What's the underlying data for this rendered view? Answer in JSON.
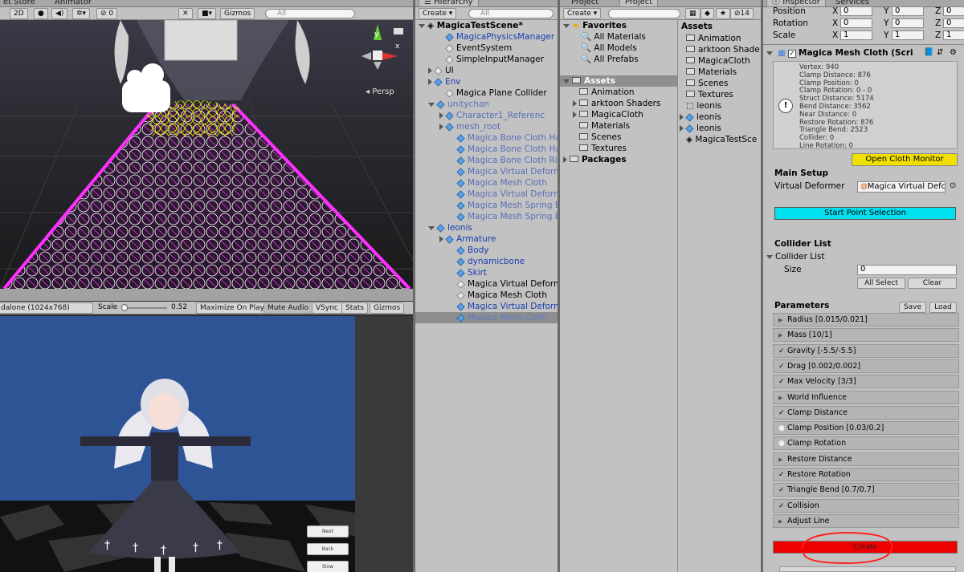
{
  "scene_view": {
    "tabs": [
      "et Store",
      "Animator"
    ],
    "toolbar": {
      "mode_2d": "2D",
      "counter": "0",
      "gizmos": "Gizmos",
      "search_placeholder": "All"
    },
    "persp_label": "Persp",
    "gizmo_axes": {
      "y": "y",
      "x": "x"
    }
  },
  "game_view": {
    "toolbar": {
      "resolution": "dalone (1024x768)",
      "scale_label": "Scale",
      "scale_value": "0.52",
      "maximize": "Maximize On Play",
      "mute": "Mute Audio",
      "vsync": "VSync",
      "stats": "Stats",
      "gizmos": "Gizmos"
    },
    "buttons": [
      "Next",
      "Back",
      "Slow"
    ]
  },
  "hierarchy": {
    "tab": "Hierarchy",
    "create": "Create",
    "search_placeholder": "All",
    "scene_name": "MagicaTestScene*",
    "items": [
      {
        "label": "MagicaPhysicsManager",
        "style": "blue"
      },
      {
        "label": "EventSystem",
        "style": "normal"
      },
      {
        "label": "SimpleInputManager",
        "style": "normal"
      },
      {
        "label": "UI",
        "style": "normal"
      },
      {
        "label": "Env",
        "style": "blue"
      },
      {
        "label": "Magica Plane Collider",
        "style": "normal"
      },
      {
        "label": "unitychan",
        "style": "faded"
      },
      {
        "label": "Character1_Referenc",
        "style": "faded"
      },
      {
        "label": "mesh_root",
        "style": "faded"
      },
      {
        "label": "Magica Bone Cloth Ha",
        "style": "faded"
      },
      {
        "label": "Magica Bone Cloth Ha",
        "style": "faded"
      },
      {
        "label": "Magica Bone Cloth Rib",
        "style": "faded"
      },
      {
        "label": "Magica Virtual Deform",
        "style": "faded"
      },
      {
        "label": "Magica Mesh Cloth",
        "style": "faded"
      },
      {
        "label": "Magica Virtual Deform",
        "style": "faded"
      },
      {
        "label": "Magica Mesh Spring B",
        "style": "faded"
      },
      {
        "label": "Magica Mesh Spring B",
        "style": "faded"
      },
      {
        "label": "leonis",
        "style": "blue"
      },
      {
        "label": "Armature",
        "style": "blue"
      },
      {
        "label": "Body",
        "style": "blue"
      },
      {
        "label": "dynamicbone",
        "style": "blue"
      },
      {
        "label": "Skirt",
        "style": "blue"
      },
      {
        "label": "Magica Virtual Deform",
        "style": "normal"
      },
      {
        "label": "Magica Mesh Cloth",
        "style": "normal"
      },
      {
        "label": "Magica Virtual Deform",
        "style": "blue"
      },
      {
        "label": "Magica Mesh Cloth",
        "style": "selected"
      }
    ]
  },
  "project": {
    "tabs": [
      "Project",
      "Project"
    ],
    "create": "Create",
    "count": "14",
    "favorites_label": "Favorites",
    "favorites": [
      "All Materials",
      "All Models",
      "All Prefabs"
    ],
    "assets_label": "Assets",
    "asset_folders": [
      "Animation",
      "arktoon Shaders",
      "MagicaCloth",
      "Materials",
      "Scenes",
      "Textures"
    ],
    "packages_label": "Packages",
    "assets_header": "Assets",
    "asset_items": [
      "Animation",
      "arktoon Shade",
      "MagicaCloth",
      "Materials",
      "Scenes",
      "Textures",
      "leonis",
      "leonis",
      "leonis",
      "MagicaTestSce"
    ]
  },
  "inspector": {
    "tabs": [
      "Inspector",
      "Services"
    ],
    "transform": {
      "position_label": "Position",
      "rotation_label": "Rotation",
      "scale_label": "Scale",
      "axes": [
        "X",
        "Y",
        "Z"
      ],
      "position": [
        "0",
        "0",
        "0"
      ],
      "rotation": [
        "0",
        "0",
        "0"
      ],
      "scale": [
        "1",
        "1",
        "1"
      ]
    },
    "component_title": "Magica Mesh Cloth (Scri",
    "stats": [
      "Vertex: 940",
      "Clamp Distance: 876",
      "Clamp Position: 0",
      "Clamp Rotation: 0 - 0",
      "Struct Distance: 5174",
      "Bend Distance: 3562",
      "Near Distance: 0",
      "Restore Rotation: 876",
      "Triangle Bend: 2523",
      "Collider: 0",
      "Line Rotation: 0"
    ],
    "open_cloth_monitor": "Open Cloth Monitor",
    "main_setup_label": "Main Setup",
    "virtual_deformer_label": "Virtual Deformer",
    "virtual_deformer_value": "Magica Virtual Defc",
    "start_point_selection": "Start Point Selection",
    "collider_list_header": "Collider List",
    "collider_list_foldout": "Collider List",
    "size_label": "Size",
    "size_value": "0",
    "all_select": "All Select",
    "clear": "Clear",
    "parameters_label": "Parameters",
    "save": "Save",
    "load": "Load",
    "params": [
      {
        "label": "Radius [0.015/0.021]",
        "mark": "arrow"
      },
      {
        "label": "Mass [10/1]",
        "mark": "arrow"
      },
      {
        "label": "Gravity [-5.5/-5.5]",
        "mark": "check"
      },
      {
        "label": "Drag [0.002/0.002]",
        "mark": "check"
      },
      {
        "label": "Max Velocity [3/3]",
        "mark": "check"
      },
      {
        "label": "World Influence",
        "mark": "arrow"
      },
      {
        "label": "Clamp Distance",
        "mark": "check"
      },
      {
        "label": "Clamp Position [0.03/0.2]",
        "mark": "dot"
      },
      {
        "label": "Clamp Rotation",
        "mark": "dot"
      },
      {
        "label": "Restore Distance",
        "mark": "arrow"
      },
      {
        "label": "Restore Rotation",
        "mark": "check"
      },
      {
        "label": "Triangle Bend [0.7/0.7]",
        "mark": "check"
      },
      {
        "label": "Collision",
        "mark": "check"
      },
      {
        "label": "Adjust Line",
        "mark": "arrow"
      }
    ],
    "create_button": "Create",
    "colors": {
      "cyan_button": "#00e0ee",
      "yellow_button": "#f0e000",
      "red_button": "#ee0000",
      "annotation_circle": "#ff2020"
    }
  }
}
